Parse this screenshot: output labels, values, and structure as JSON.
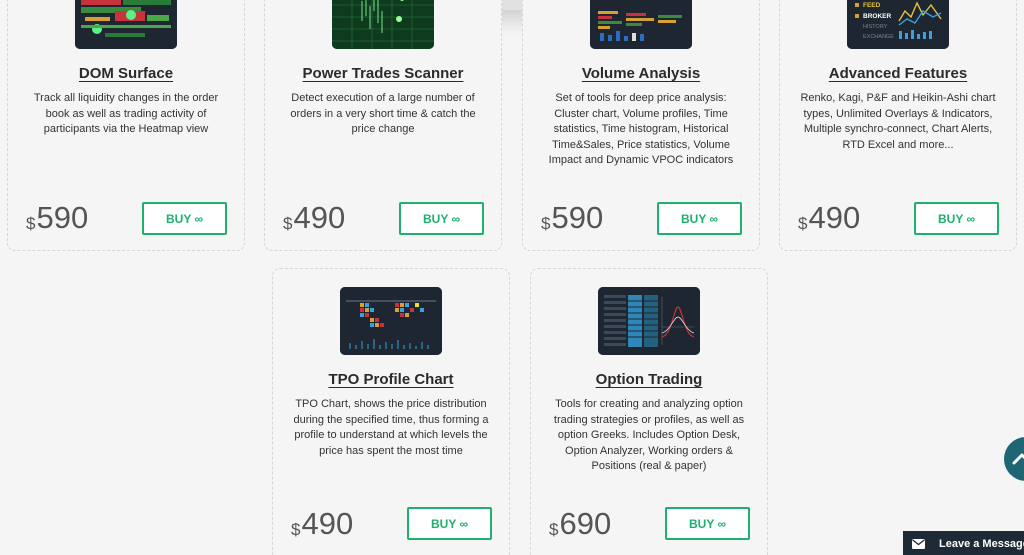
{
  "products": [
    {
      "id": "dom",
      "title": "DOM Surface",
      "desc": "Track all liquidity changes in the order book as well as trading activity of participants via the Heatmap view",
      "currency": "$",
      "price": "590",
      "buy_label": "BUY ∞"
    },
    {
      "id": "power",
      "title": "Power Trades Scanner",
      "desc": "Detect execution of a large number of orders in a very short time & catch the price change",
      "currency": "$",
      "price": "490",
      "buy_label": "BUY ∞"
    },
    {
      "id": "volume",
      "title": "Volume Analysis",
      "desc": "Set of tools for deep price analysis: Cluster chart, Volume profiles, Time statistics, Time histogram, Historical Time&Sales, Price statistics, Volume Impact and Dynamic VPOC indicators",
      "currency": "$",
      "price": "590",
      "buy_label": "BUY ∞"
    },
    {
      "id": "advanced",
      "title": "Advanced Features",
      "desc": "Renko, Kagi, P&F and Heikin-Ashi chart types, Unlimited Overlays & Indicators, Multiple synchro-connect, Chart Alerts, RTD Excel and more...",
      "currency": "$",
      "price": "490",
      "buy_label": "BUY ∞",
      "thumb_labels": [
        "FEED",
        "BROKER",
        "HISTORY",
        "EXCHANGE"
      ]
    },
    {
      "id": "tpo",
      "title": "TPO Profile Chart",
      "desc": "TPO Chart, shows the price distribution during the specified time, thus forming a profile to understand at which levels the price has spent the most time",
      "currency": "$",
      "price": "490",
      "buy_label": "BUY ∞"
    },
    {
      "id": "option",
      "title": "Option Trading",
      "desc": "Tools for creating and analyzing option trading strategies or profiles, as well as option Greeks. Includes Option Desk, Option Analyzer, Working orders & Positions (real & paper)",
      "currency": "$",
      "price": "690",
      "buy_label": "BUY ∞"
    }
  ],
  "chat": {
    "label": "Leave a Message"
  },
  "colors": {
    "accent": "#1faf6e",
    "thumb_bg": "#1e2731",
    "scroll_btn": "#1e6674",
    "chat_bar": "#1e2a36"
  },
  "icons": {
    "scroll_top": "chevron-up-icon",
    "chat": "envelope-icon"
  }
}
